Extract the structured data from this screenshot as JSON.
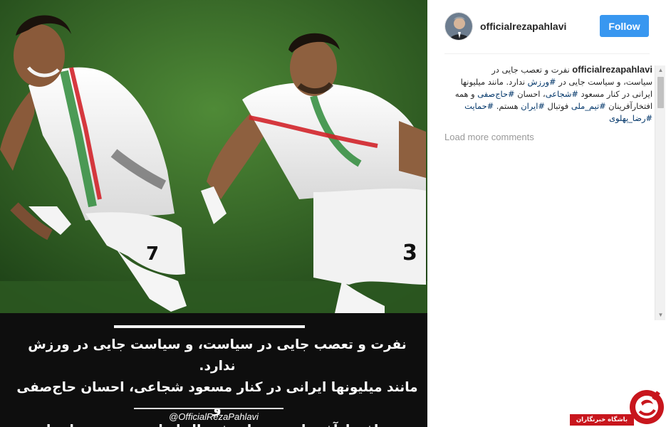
{
  "post": {
    "username": "officialrezapahlavi",
    "follow_label": "Follow",
    "image": {
      "jersey_left_number": "7",
      "jersey_right_number": "3",
      "caption_lines": [
        "نفرت و تعصب جایی در سیاست، و سیاست جایی در ورزش ندارد.",
        "مانند میلیونها ایرانی در کنار مسعود شجاعی، احسان حاج‌صفی و",
        "همه افتخارآفرینان تیم ملی فوتبال ایران هستم. رضا پهلوی"
      ],
      "caption_handle": "@OfficialRezaPahlavi"
    }
  },
  "comments": {
    "caption_user": "officialrezapahlavi",
    "lines": [
      [
        {
          "t": "نفرت و تعصب جایی در"
        }
      ],
      [
        {
          "t": "سیاست، و سیاست جایی در "
        },
        {
          "t": "#ورزش",
          "tag": true
        },
        {
          "t": " ندارد. مانند میلیونها"
        }
      ],
      [
        {
          "t": "ایرانی در کنار مسعود "
        },
        {
          "t": "#شجاعی",
          "tag": true
        },
        {
          "t": "، احسان "
        },
        {
          "t": "#حاج‌صفی",
          "tag": true
        },
        {
          "t": " و همه"
        }
      ],
      [
        {
          "t": "افتخارآفرینان "
        },
        {
          "t": "#تیم_ملی",
          "tag": true
        },
        {
          "t": " فوتبال "
        },
        {
          "t": "#ایران",
          "tag": true
        },
        {
          "t": " هستم. "
        },
        {
          "t": "#حمایت",
          "tag": true
        }
      ],
      [
        {
          "t": "#رضا_پهلوی",
          "tag": true
        }
      ]
    ],
    "load_more": "Load more comments"
  },
  "watermark": {
    "text": "باشگاه خبرنگاران",
    "brand_color": "#c8161d"
  },
  "colors": {
    "follow_button": "#3897f0",
    "hashtag": "#003569",
    "muted_text": "#999999"
  },
  "icons": [
    "scroll-up-arrow-icon",
    "scroll-down-arrow-icon",
    "watermark-logo-icon"
  ]
}
